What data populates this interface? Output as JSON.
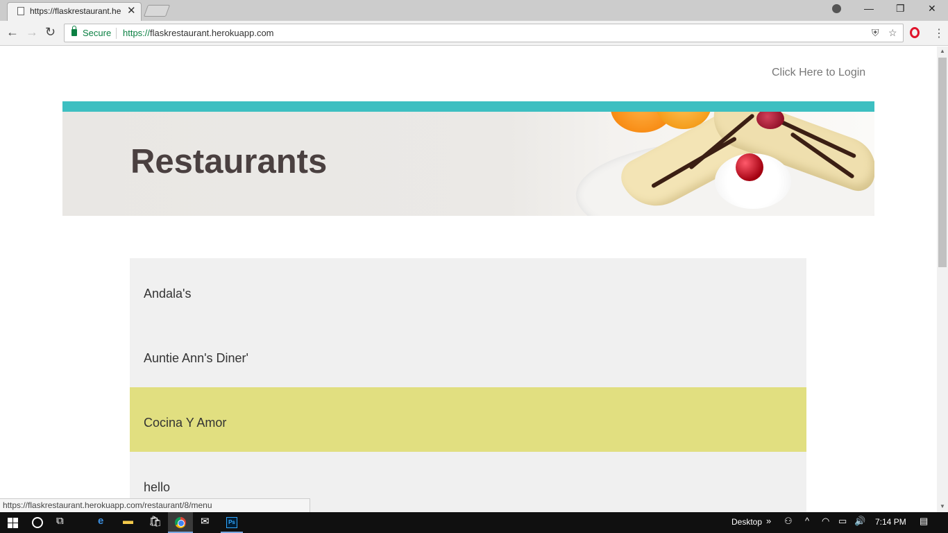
{
  "browser": {
    "tab_title": "https://flaskrestaurant.he",
    "secure_label": "Secure",
    "url_scheme": "https://",
    "url_host": "flaskrestaurant.herokuapp.com",
    "status_url": "https://flaskrestaurant.herokuapp.com/restaurant/8/menu"
  },
  "page": {
    "login_link": "Click Here to Login",
    "banner_title": "Restaurants",
    "accent_color": "#3dbfc1",
    "highlight_color": "#e1df80",
    "restaurants": [
      {
        "name": "Andala's",
        "highlighted": false
      },
      {
        "name": "Auntie Ann's Diner'",
        "highlighted": false
      },
      {
        "name": "Cocina Y Amor",
        "highlighted": true
      },
      {
        "name": "hello",
        "highlighted": false
      }
    ]
  },
  "taskbar": {
    "desktop_label": "Desktop",
    "clock": "7:14 PM"
  }
}
